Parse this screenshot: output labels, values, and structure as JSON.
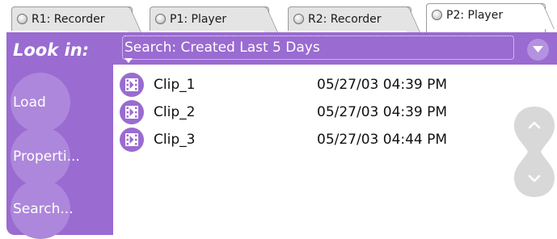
{
  "tabs": [
    {
      "label": "R1: Recorder",
      "active": false
    },
    {
      "label": "P1: Player",
      "active": false
    },
    {
      "label": "R2: Recorder",
      "active": false
    },
    {
      "label": "P2: Player",
      "active": true
    }
  ],
  "sidebar": {
    "title": "Look in:",
    "buttons": [
      {
        "label": "Load"
      },
      {
        "label": "Properti..."
      },
      {
        "label": "Search..."
      }
    ]
  },
  "search": {
    "value": "Search: Created Last 5 Days"
  },
  "clips": [
    {
      "name": "Clip_1",
      "date": "05/27/03 04:39 PM",
      "icon": "film-clip-icon"
    },
    {
      "name": "Clip_2",
      "date": "05/27/03 04:39 PM",
      "icon": "film-clip-icon"
    },
    {
      "name": "Clip_3",
      "date": "05/27/03 04:44 PM",
      "icon": "film-clip-icon"
    }
  ],
  "scroll": {
    "up_icon": "chevron-up-icon",
    "down_icon": "chevron-down-icon"
  },
  "colors": {
    "accent": "#9a6bd1",
    "button": "#ad87db",
    "scroll": "#d8d8d8",
    "text": "#111111"
  }
}
